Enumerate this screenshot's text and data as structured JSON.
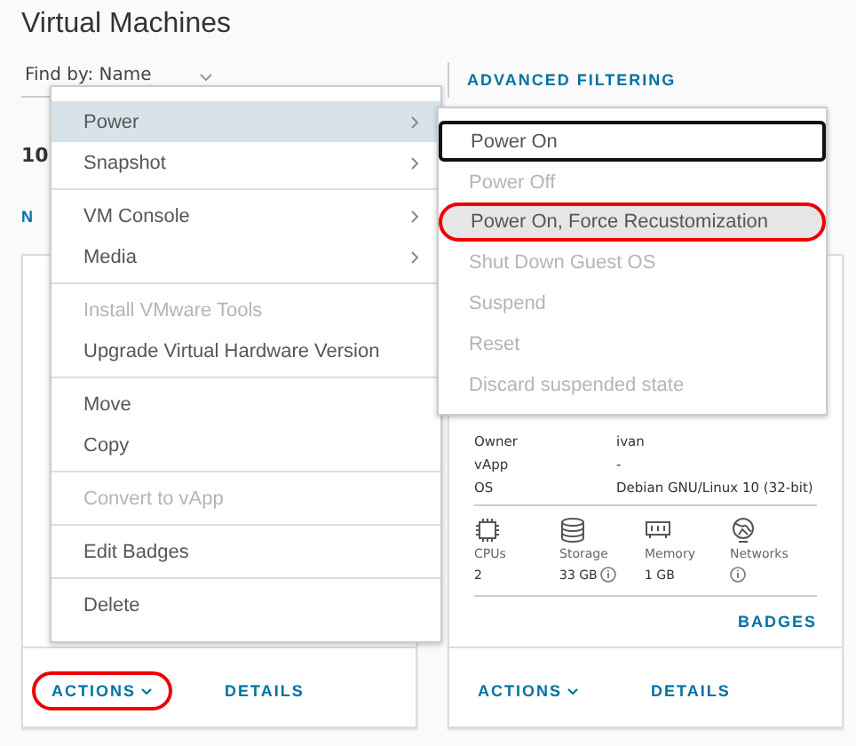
{
  "page": {
    "title": "Virtual Machines"
  },
  "filter": {
    "find_by": "Find by: Name",
    "advanced": "ADVANCED FILTERING"
  },
  "count": "10",
  "link_fragment": "N",
  "cards": [
    {
      "actions": {
        "label": "ACTIONS",
        "circled": true
      },
      "details_link": "DETAILS"
    },
    {
      "details": [
        {
          "label": "Owner",
          "value": "ivan"
        },
        {
          "label": "vApp",
          "value": "-"
        },
        {
          "label": "OS",
          "value": "Debian GNU/Linux 10 (32-bit)"
        }
      ],
      "stats": [
        {
          "kind": "cpu",
          "label": "CPUs",
          "value": "2",
          "info": false
        },
        {
          "kind": "storage",
          "label": "Storage",
          "value": "33 GB",
          "info": true
        },
        {
          "kind": "memory",
          "label": "Memory",
          "value": "1 GB",
          "info": false
        },
        {
          "kind": "network",
          "label": "Networks",
          "info": true
        }
      ],
      "badges": "BADGES",
      "actions": {
        "label": "ACTIONS",
        "circled": false
      },
      "details_link": "DETAILS"
    }
  ],
  "menu": {
    "groups": [
      [
        {
          "label": "Power",
          "submenu": true,
          "selected": true,
          "disabled": false
        },
        {
          "label": "Snapshot",
          "submenu": true,
          "selected": false,
          "disabled": false
        }
      ],
      [
        {
          "label": "VM Console",
          "submenu": true,
          "selected": false,
          "disabled": false
        },
        {
          "label": "Media",
          "submenu": true,
          "selected": false,
          "disabled": false
        }
      ],
      [
        {
          "label": "Install VMware Tools",
          "submenu": false,
          "selected": false,
          "disabled": true
        },
        {
          "label": "Upgrade Virtual Hardware Version",
          "submenu": false,
          "selected": false,
          "disabled": false
        }
      ],
      [
        {
          "label": "Move",
          "submenu": false,
          "selected": false,
          "disabled": false
        },
        {
          "label": "Copy",
          "submenu": false,
          "selected": false,
          "disabled": false
        }
      ],
      [
        {
          "label": "Convert to vApp",
          "submenu": false,
          "selected": false,
          "disabled": true
        }
      ],
      [
        {
          "label": "Edit Badges",
          "submenu": false,
          "selected": false,
          "disabled": false
        }
      ],
      [
        {
          "label": "Delete",
          "submenu": false,
          "selected": false,
          "disabled": false
        }
      ]
    ]
  },
  "submenu": [
    {
      "label": "Power On",
      "disabled": false,
      "focused": true,
      "selected": false,
      "circled": false
    },
    {
      "label": "Power Off",
      "disabled": true,
      "focused": false,
      "selected": false,
      "circled": false
    },
    {
      "label": "Power On, Force Recustomization",
      "disabled": false,
      "focused": false,
      "selected": true,
      "circled": true
    },
    {
      "label": "Shut Down Guest OS",
      "disabled": true,
      "focused": false,
      "selected": false,
      "circled": false
    },
    {
      "label": "Suspend",
      "disabled": true,
      "focused": false,
      "selected": false,
      "circled": false
    },
    {
      "label": "Reset",
      "disabled": true,
      "focused": false,
      "selected": false,
      "circled": false
    },
    {
      "label": "Discard suspended state",
      "disabled": true,
      "focused": false,
      "selected": false,
      "circled": false
    }
  ]
}
